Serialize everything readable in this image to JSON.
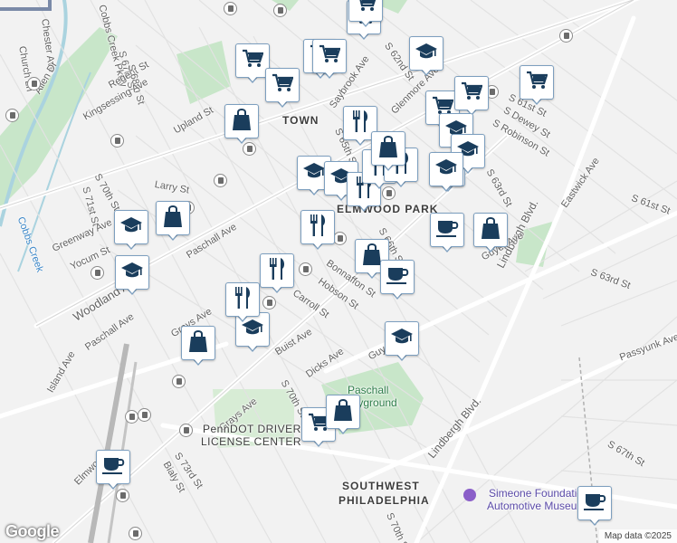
{
  "map": {
    "neighborhoods": [
      "ELMWOOD PARK",
      "SOUTHWEST",
      "PHILADELPHIA"
    ],
    "partial_labels": [
      "TOWN"
    ],
    "streets": [
      "Cobbs Creek Pkwy",
      "Church Ln",
      "Chester Ave",
      "Allen Dr",
      "S 67th St",
      "Regent St",
      "S 68th St",
      "Kingsessing Ave",
      "Upland St",
      "Larry St",
      "S 70th St",
      "S 71st St",
      "Greenway Ave",
      "Yocum St",
      "Woodland Ave",
      "Paschall Ave",
      "Island Ave",
      "Grays Ave",
      "Buist Ave",
      "Dicks Ave",
      "Carroll St",
      "Hobson St",
      "Bonnaffon St",
      "S 66th St",
      "S 65th St",
      "Saybrook Ave",
      "Glenmore Ave",
      "S 61st St",
      "S Dewey St",
      "S Robinson St",
      "S 63rd St",
      "Lindbergh Blvd.",
      "Eastwick Ave",
      "S 61st St",
      "S 63rd St",
      "Passyunk Ave",
      "Guyer Ave",
      "S 67th St",
      "S 73rd St",
      "Bialy St",
      "Elmwood",
      "S 70th St",
      "Chester Ave",
      "S 62nd St",
      "Cobbs Cr"
    ],
    "water": [
      "Cobbs Creek"
    ],
    "parks": [
      "Paschall",
      "Playground"
    ],
    "places": [
      "PennDOT DRIVER",
      "LICENSE CENTER",
      "Simeone Foundation",
      "Automotive Museum"
    ],
    "logo": "Google",
    "attribution": "Map data ©2025"
  },
  "colors": {
    "map_background": "#f2f2f2",
    "park": "#c8e6c9",
    "water": "#aad3df",
    "major_road": "#ffffff",
    "highway": "#ffffff",
    "marker_icon": "#1a3d5c",
    "marker_border": "#7d9fbf"
  },
  "markers": [
    {
      "icon": "cart-icon"
    },
    {
      "icon": "cart-icon"
    },
    {
      "icon": "cart-icon"
    },
    {
      "icon": "cart-icon"
    },
    {
      "icon": "cart-icon"
    },
    {
      "icon": "cart-icon"
    },
    {
      "icon": "cart-icon"
    },
    {
      "icon": "cart-icon"
    },
    {
      "icon": "cart-icon"
    },
    {
      "icon": "cart-icon"
    },
    {
      "icon": "school-icon"
    },
    {
      "icon": "school-icon"
    },
    {
      "icon": "school-icon"
    },
    {
      "icon": "school-icon"
    },
    {
      "icon": "school-icon"
    },
    {
      "icon": "school-icon"
    },
    {
      "icon": "school-icon"
    },
    {
      "icon": "school-icon"
    },
    {
      "icon": "school-icon"
    },
    {
      "icon": "school-icon"
    },
    {
      "icon": "school-icon"
    },
    {
      "icon": "restaurant-icon"
    },
    {
      "icon": "restaurant-icon"
    },
    {
      "icon": "restaurant-icon"
    },
    {
      "icon": "restaurant-icon"
    },
    {
      "icon": "restaurant-icon"
    },
    {
      "icon": "restaurant-icon"
    },
    {
      "icon": "restaurant-icon"
    },
    {
      "icon": "shopping-bag-icon"
    },
    {
      "icon": "shopping-bag-icon"
    },
    {
      "icon": "shopping-bag-icon"
    },
    {
      "icon": "shopping-bag-icon"
    },
    {
      "icon": "shopping-bag-icon"
    },
    {
      "icon": "shopping-bag-icon"
    },
    {
      "icon": "shopping-bag-icon"
    },
    {
      "icon": "coffee-icon"
    },
    {
      "icon": "coffee-icon"
    },
    {
      "icon": "coffee-icon"
    },
    {
      "icon": "coffee-icon"
    }
  ]
}
